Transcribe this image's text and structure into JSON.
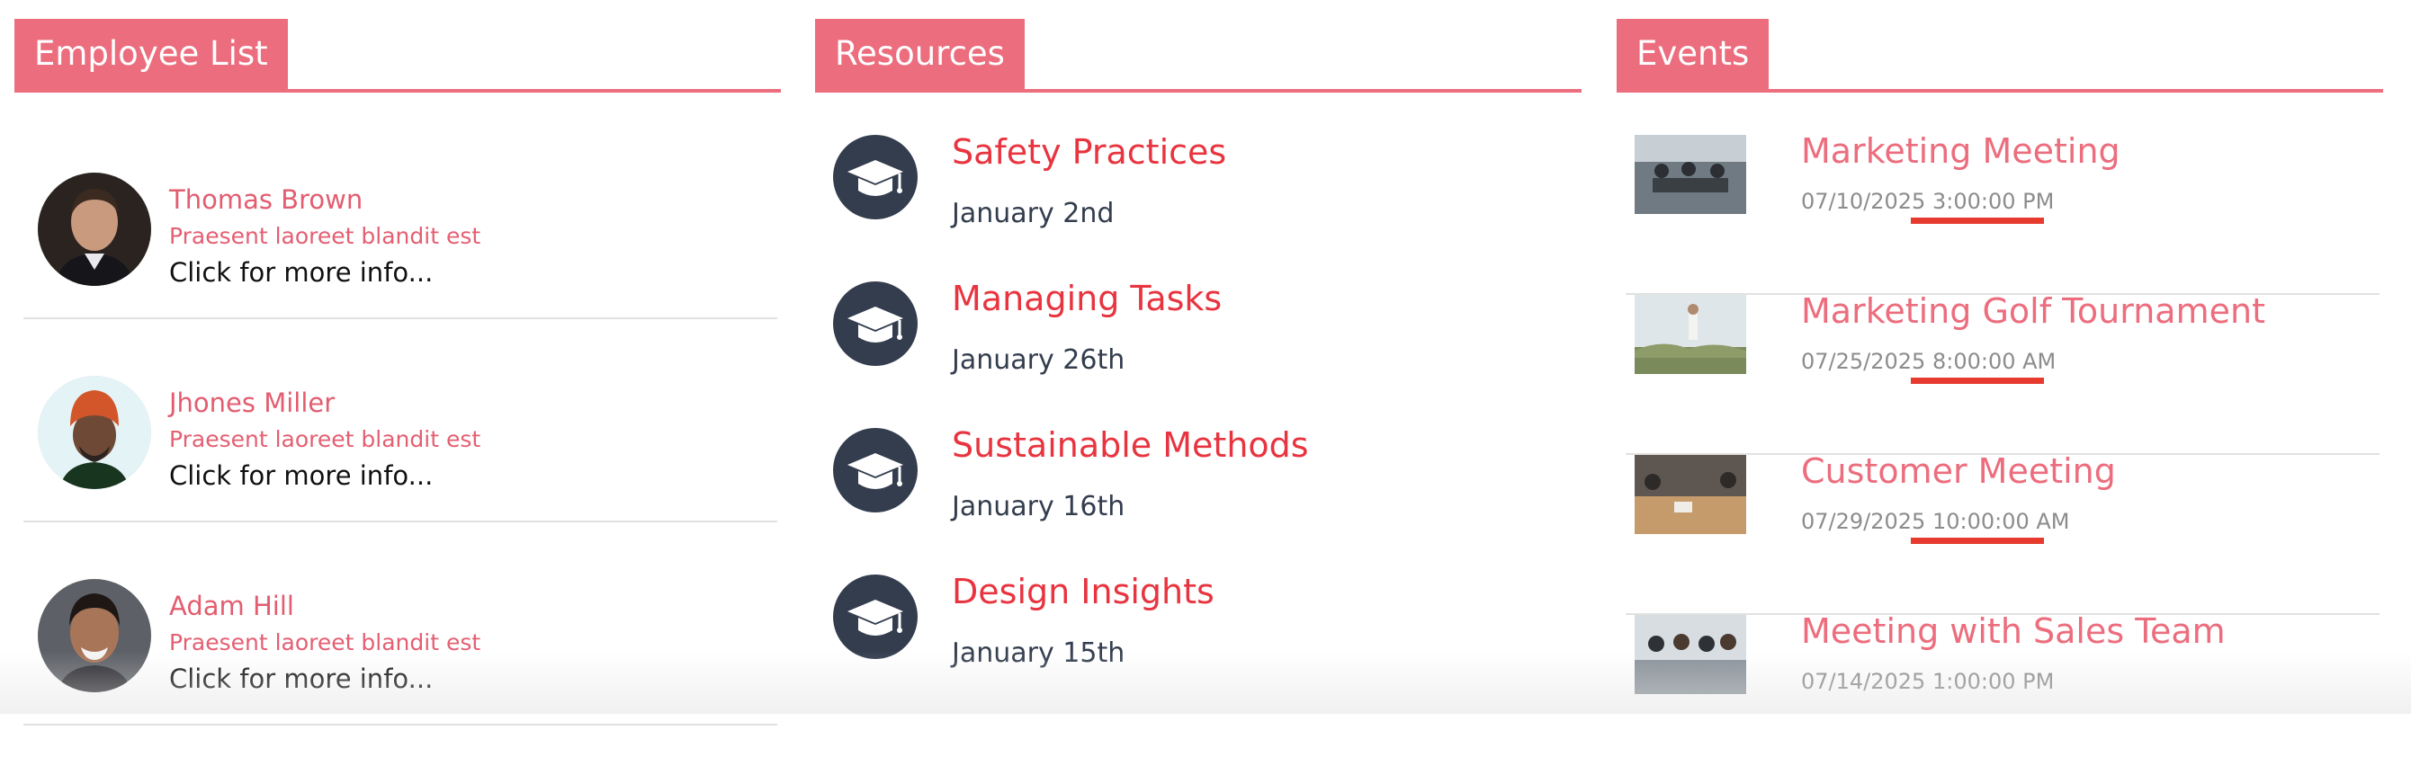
{
  "employees": {
    "title": "Employee List",
    "items": [
      {
        "name": "Thomas Brown",
        "subtitle": "Praesent laoreet blandit est",
        "more": "Click for more info..."
      },
      {
        "name": "Jhones Miller",
        "subtitle": "Praesent laoreet blandit est",
        "more": "Click for more info..."
      },
      {
        "name": "Adam Hill",
        "subtitle": "Praesent laoreet blandit est",
        "more": "Click for more info..."
      }
    ]
  },
  "resources": {
    "title": "Resources",
    "icon": "graduation-cap-icon",
    "items": [
      {
        "title": "Safety Practices",
        "date": "January 2nd"
      },
      {
        "title": "Managing Tasks",
        "date": "January 26th"
      },
      {
        "title": "Sustainable Methods",
        "date": "January 16th"
      },
      {
        "title": "Design Insights",
        "date": "January 15th"
      }
    ]
  },
  "events": {
    "title": "Events",
    "items": [
      {
        "title": "Marketing Meeting",
        "date": "07/10/2025",
        "time": "3:00:00 PM"
      },
      {
        "title": "Marketing Golf Tournament",
        "date": "07/25/2025",
        "time": "8:00:00 AM"
      },
      {
        "title": "Customer Meeting",
        "date": "07/29/2025",
        "time": "10:00:00 AM"
      },
      {
        "title": "Meeting with Sales Team",
        "date": "07/14/2025",
        "time": "1:00:00 PM"
      }
    ]
  },
  "colors": {
    "accent": "#ec6d7d",
    "resource_title": "#e8343f",
    "icon_bg": "#333d4e",
    "annotation_underline": "#e63b2e"
  }
}
